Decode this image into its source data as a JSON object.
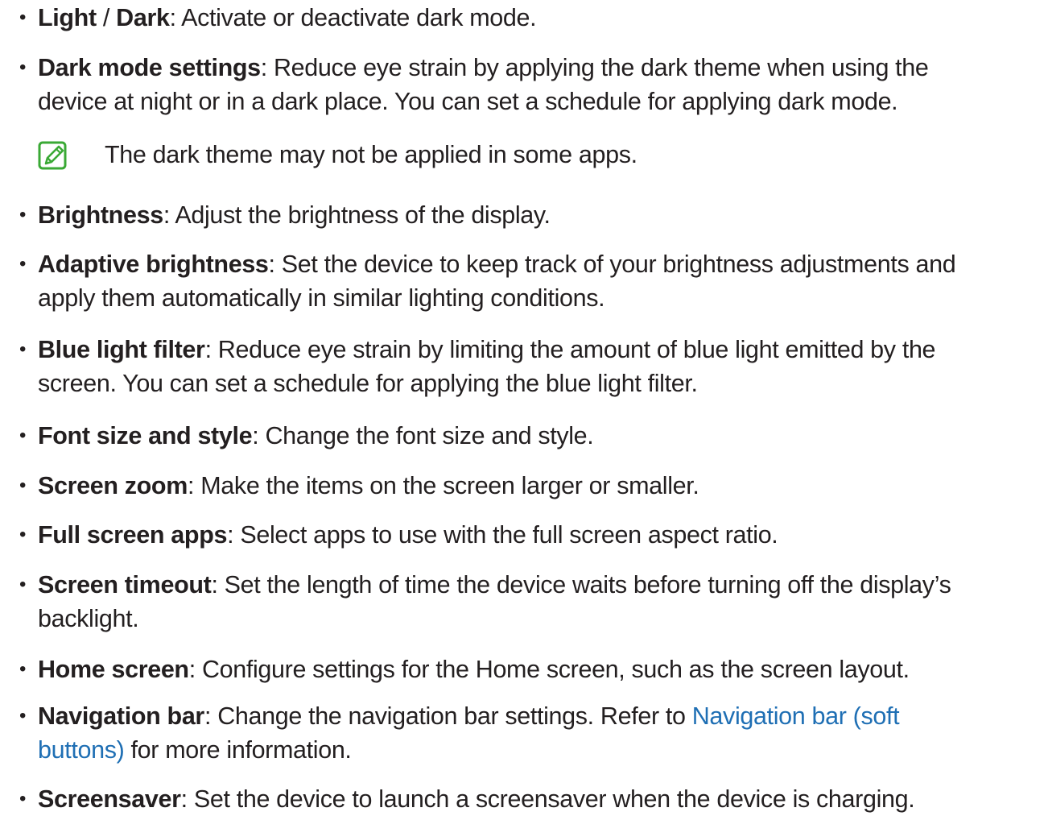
{
  "items": [
    {
      "term_a": "Light",
      "separator": " / ",
      "term_b": "Dark",
      "desc": ": Activate or deactivate dark mode."
    },
    {
      "term": "Dark mode settings",
      "desc_line1": ": Reduce eye strain by applying the dark theme when using the",
      "desc_line2": "device at night or in a dark place. You can set a schedule for applying dark mode."
    },
    {
      "note": "The dark theme may not be applied in some apps.",
      "note_icon": "note-pencil-icon",
      "note_icon_color": "#3aa935"
    },
    {
      "term": "Brightness",
      "desc": ": Adjust the brightness of the display."
    },
    {
      "term": "Adaptive brightness",
      "desc_line1": ": Set the device to keep track of your brightness adjustments and",
      "desc_line2": "apply them automatically in similar lighting conditions."
    },
    {
      "term": "Blue light filter",
      "desc_line1": ": Reduce eye strain by limiting the amount of blue light emitted by the",
      "desc_line2": "screen. You can set a schedule for applying the blue light filter."
    },
    {
      "term": "Font size and style",
      "desc": ": Change the font size and style."
    },
    {
      "term": "Screen zoom",
      "desc": ": Make the items on the screen larger or smaller."
    },
    {
      "term": "Full screen apps",
      "desc": ": Select apps to use with the full screen aspect ratio."
    },
    {
      "term": "Screen timeout",
      "desc_line1": ": Set the length of time the device waits before turning off the display’s",
      "desc_line2": "backlight."
    },
    {
      "term": "Home screen",
      "desc": ": Configure settings for the Home screen, such as the screen layout."
    },
    {
      "term": "Navigation bar",
      "desc_line1_pre": ": Change the navigation bar settings. Refer to ",
      "link_part1": "Navigation bar (soft",
      "link_part2": "buttons)",
      "desc_line2_post": " for more information."
    },
    {
      "term": "Screensaver",
      "desc": ": Set the device to launch a screensaver when the device is charging."
    }
  ],
  "bullet": "•",
  "colors": {
    "text": "#231f20",
    "link": "#1f6fb4",
    "note_icon": "#3aa935"
  }
}
